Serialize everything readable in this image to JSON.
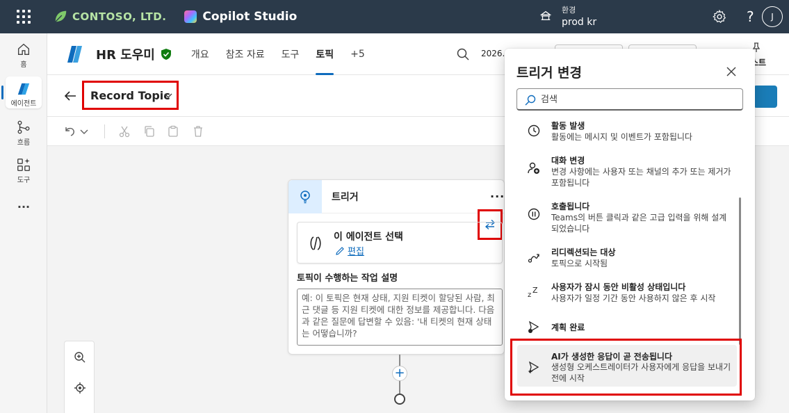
{
  "topbar": {
    "org_name": "CONTOSO, LTD.",
    "app_name": "Copilot Studio",
    "env_label": "환경",
    "env_value": "prod kr",
    "help": "?",
    "avatar_initial": "J"
  },
  "rail": {
    "items": [
      {
        "label": "홈",
        "icon": "home-icon"
      },
      {
        "label": "에이전트",
        "icon": "agent-icon"
      },
      {
        "label": "흐름",
        "icon": "flow-icon"
      },
      {
        "label": "도구",
        "icon": "tools-icon"
      }
    ],
    "more": "···"
  },
  "agent": {
    "name": "HR 도우미",
    "tabs": [
      {
        "label": "개요",
        "active": false
      },
      {
        "label": "참조 자료",
        "active": false
      },
      {
        "label": "도구",
        "active": false
      },
      {
        "label": "토픽",
        "active": true
      },
      {
        "label": "+5",
        "active": false
      }
    ],
    "date_text": "2026. ",
    "test_label": "스트"
  },
  "topic": {
    "title": "Record Topic"
  },
  "node": {
    "title": "트리거",
    "more": "···",
    "card_title": "이 에이전트 선택",
    "card_edit": "편집",
    "desc_label": "토픽이 수행하는 작업 설명",
    "desc_placeholder": "예: 이 토픽은 현재 상태, 지원 티켓이 할당된 사람, 최근 댓글 등 지원 티켓에 대한 정보를 제공합니다. 다음과 같은 질문에 답변할 수 있음: '내 티켓의 현재 상태는 어떻습니까?",
    "add": "+"
  },
  "panel": {
    "title": "트리거 변경",
    "search_placeholder": "검색",
    "triggers": [
      {
        "title": "활동 발생",
        "desc": "활동에는 메시지 및 이벤트가 포함됩니다",
        "icon": "clock-icon"
      },
      {
        "title": "대화 변경",
        "desc": "변경 사항에는 사용자 또는 채널의 추가 또는 제거가 포함됩니다",
        "icon": "person-add-icon"
      },
      {
        "title": "호출됩니다",
        "desc": "Teams의 버튼 클릭과 같은 고급 입력을 위해 설계되었습니다",
        "icon": "pause-circle-icon"
      },
      {
        "title": "리디렉션되는 대상",
        "desc": "토픽으로 시작됨",
        "icon": "redirect-icon"
      },
      {
        "title": "사용자가 잠시 동안 비활성 상태입니다",
        "desc": "사용자가 일정 기간 동안 사용하지 않은 후 시작",
        "icon": "sleep-icon"
      },
      {
        "title": "계획 완료",
        "desc": "",
        "icon": "plan-complete-icon"
      },
      {
        "title": "AI가 생성한 응답이 곧 전송됩니다",
        "desc": "생성형 오케스트레이터가 사용자에게 응답을 보내기 전에 시작",
        "icon": "ai-response-icon"
      }
    ]
  },
  "colors": {
    "topbar_bg": "#2b3a4a",
    "accent": "#0f6cbd",
    "highlight_red": "#e00000",
    "verified_green": "#107c10"
  }
}
